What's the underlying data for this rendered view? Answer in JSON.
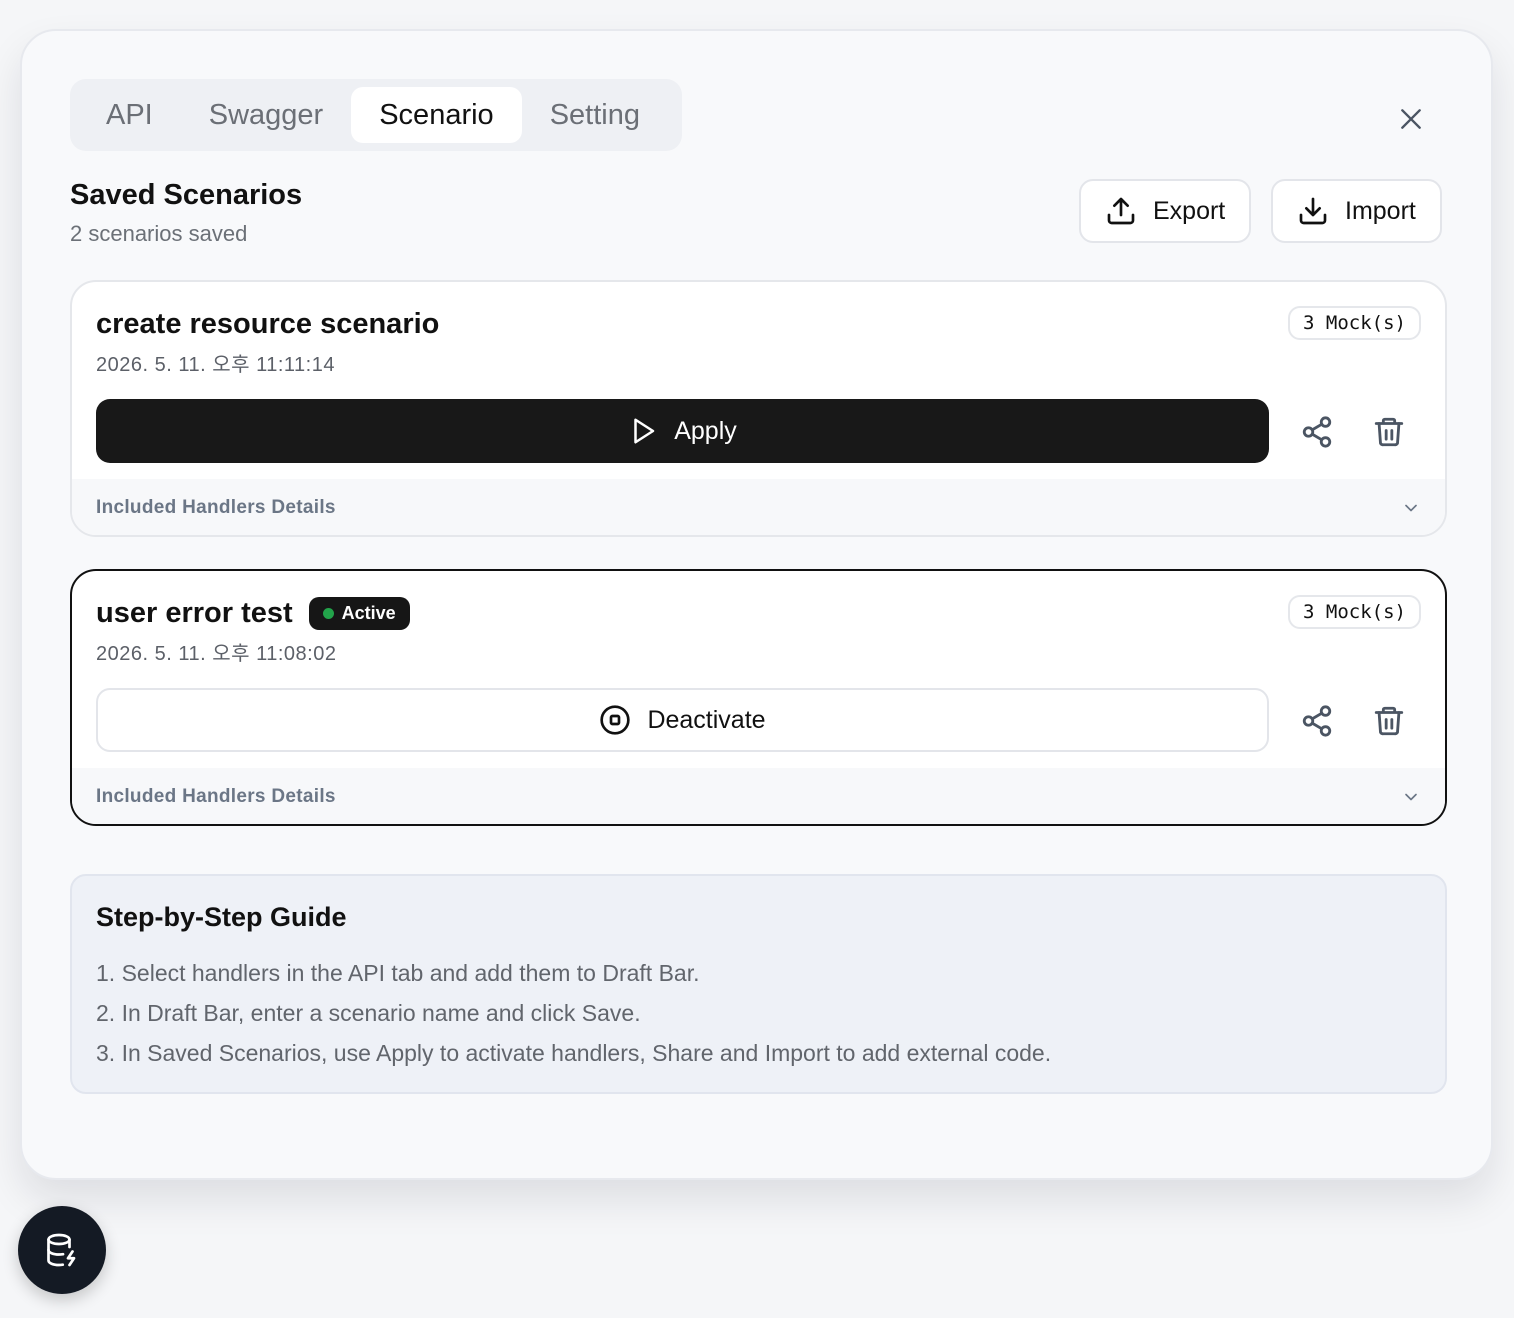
{
  "tabs": [
    {
      "label": "API",
      "active": false
    },
    {
      "label": "Swagger",
      "active": false
    },
    {
      "label": "Scenario",
      "active": true
    },
    {
      "label": "Setting",
      "active": false
    }
  ],
  "header": {
    "title": "Saved Scenarios",
    "subtitle": "2 scenarios saved",
    "export_label": "Export",
    "import_label": "Import"
  },
  "scenarios": [
    {
      "name": "create resource scenario",
      "date": "2026. 5. 11. 오후 11:11:14",
      "mock_count": "3 Mock(s)",
      "active": false,
      "action_label": "Apply",
      "details_label": "Included Handlers Details"
    },
    {
      "name": "user error test",
      "status_badge": "Active",
      "date": "2026. 5. 11. 오후 11:08:02",
      "mock_count": "3 Mock(s)",
      "active": true,
      "action_label": "Deactivate",
      "details_label": "Included Handlers Details"
    }
  ],
  "guide": {
    "title": "Step-by-Step Guide",
    "steps": [
      "1. Select handlers in the API tab and add them to Draft Bar.",
      "2. In Draft Bar, enter a scenario name and click Save.",
      "3. In Saved Scenarios, use Apply to activate handlers, Share and Import to add external code."
    ]
  },
  "colors": {
    "primary_button": "#181818",
    "active_dot": "#22a34a",
    "fab_background": "#141a24"
  },
  "icons": {
    "close": "close-icon",
    "export": "upload-icon",
    "import": "download-icon",
    "apply": "play-icon",
    "deactivate": "stop-circle-icon",
    "share": "share-icon",
    "delete": "trash-icon",
    "expand": "chevron-down-icon",
    "fab": "database-bolt-icon"
  }
}
